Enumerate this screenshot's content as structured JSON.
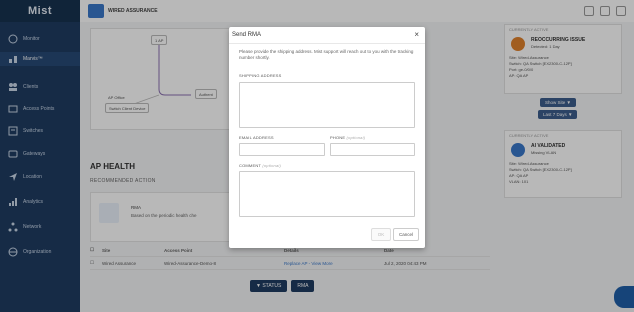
{
  "app": {
    "logo": "Mist",
    "org_title": "WIRED ASSURANCE"
  },
  "sidebar": {
    "items": [
      {
        "label": "Monitor",
        "icon": "monitor-icon"
      },
      {
        "label": "Marvis™",
        "icon": "marvis-icon"
      },
      {
        "label": "Clients",
        "icon": "clients-icon"
      },
      {
        "label": "Access Points",
        "icon": "access-points-icon"
      },
      {
        "label": "Switches",
        "icon": "switches-icon"
      },
      {
        "label": "Gateways",
        "icon": "gateways-icon"
      },
      {
        "label": "Location",
        "icon": "location-icon"
      },
      {
        "label": "Analytics",
        "icon": "analytics-icon"
      },
      {
        "label": "Network",
        "icon": "network-icon"
      },
      {
        "label": "Organization",
        "icon": "organization-icon"
      }
    ]
  },
  "topology": {
    "node_ap": "1 AP",
    "node_auth": "Authent",
    "node_small1": "AP Office",
    "node_small2": "Switch Client Device"
  },
  "main": {
    "section_title": "AP HEALTH",
    "recommended_label": "RECOMMENDED ACTION",
    "rec_title": "RMA",
    "rec_body": "Based on the periodic health che",
    "table": {
      "headers": [
        "Site",
        "Access Point",
        "Details",
        "Date"
      ],
      "rows": [
        [
          "Wired Assurance",
          "Wired-Assurance-Demo-8",
          "Replace AP - View More",
          "Jul 2, 2020 04:43 PM"
        ]
      ]
    },
    "status_button": "▼ STATUS",
    "rma_button": "RMA"
  },
  "right": {
    "card1_label": "CURRENTLY ACTIVE",
    "card1_title": "REOCCURRING ISSUE",
    "card1_subtitle": "Detected: 1 Day",
    "card1_lines": [
      "Site: Wired-Assurance",
      "Switch: QA Switch [EX2300-C-12P]",
      "Port: ge-0/0/0",
      "AP: QA AP"
    ],
    "filter1": "Show Site ▼",
    "filter2": "Last 7 Days ▼",
    "card2_label": "CURRENTLY ACTIVE",
    "card2_title": "AI VALIDATED",
    "card2_subtitle": "Missing VLAN",
    "card2_lines": [
      "Site: Wired-Assurance",
      "Switch: QA Switch [EX2300-C-12P]",
      "AP: QA AP",
      "VLAN: 101"
    ]
  },
  "modal": {
    "title": "Send RMA",
    "close": "×",
    "description": "Please provide the shipping address. Mist support will reach out to you with the tracking number shortly.",
    "shipping_label": "SHIPPING ADDRESS",
    "email_label": "EMAIL ADDRESS",
    "phone_label": "PHONE",
    "phone_optional": "(optional)",
    "comment_label": "COMMENT",
    "comment_optional": "(optional)",
    "ok_label": "OK",
    "cancel_label": "Cancel"
  },
  "colors": {
    "sidebar": "#1f3c62",
    "accent": "#3a78c9",
    "issue_badge": "#e0822b"
  }
}
